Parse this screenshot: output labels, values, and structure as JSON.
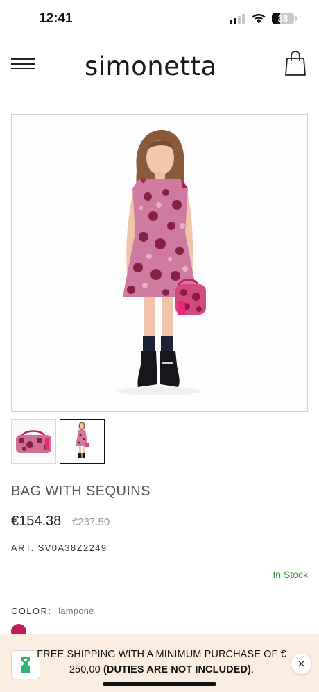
{
  "status_bar": {
    "time": "12:41",
    "battery_level": 38,
    "battery_text": "38"
  },
  "header": {
    "brand": "simonetta",
    "menu_icon": "hamburger-menu-icon",
    "cart_icon": "shopping-bag-icon"
  },
  "gallery": {
    "main_image": "girl-in-sequin-dress-with-bag-photo",
    "thumbnails": [
      {
        "name": "sequin-bag-photo",
        "selected": false
      },
      {
        "name": "girl-holding-bag-photo",
        "selected": true
      }
    ]
  },
  "product": {
    "title": "BAG WITH SEQUINS",
    "price": "€154.38",
    "old_price": "€237.50",
    "art_label": "ART.",
    "art_code": "SV0A38Z2249",
    "stock": "In Stock",
    "color_label": "COLOR:",
    "color_value": "lampone",
    "swatch_color": "#c31b5a"
  },
  "promo": {
    "text": "FREE SHIPPING WITH A MINIMUM PURCHASE OF € 250,00",
    "text_bold": "(DUTIES ARE NOT INCLUDED)",
    "text_end": ".",
    "close_label": "×",
    "ticket_icon": "ticket-icon"
  },
  "colors": {
    "accent_pink": "#c31b5a",
    "stock_green": "#3a9a3a",
    "promo_bg": "#fbeee0"
  }
}
